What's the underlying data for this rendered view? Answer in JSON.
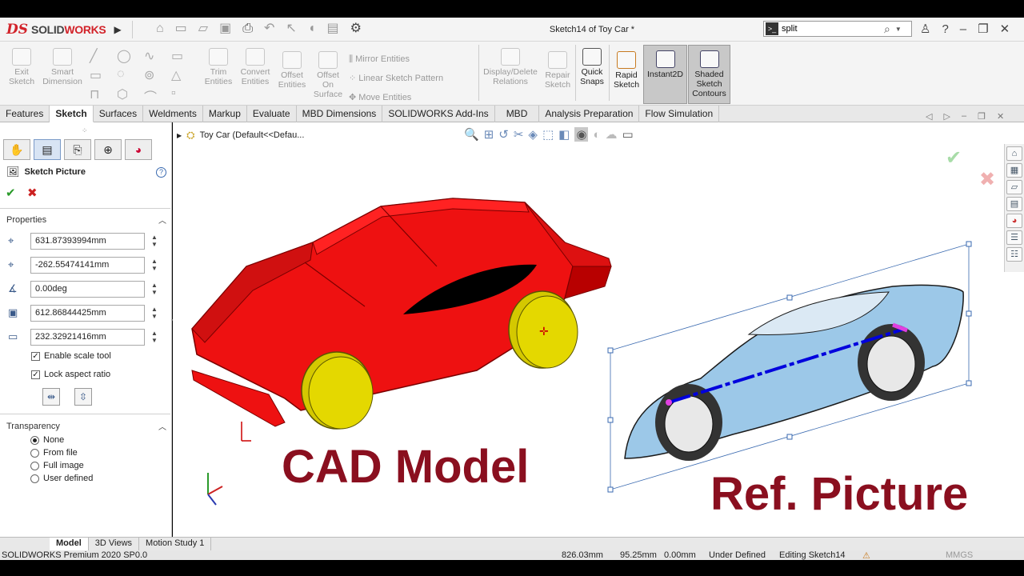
{
  "app": {
    "brand": "SOLIDWORKS",
    "document_title": "Sketch14 of Toy Car *"
  },
  "search": {
    "value": "split"
  },
  "cmd": {
    "exit_sketch": "Exit Sketch",
    "smart_dimension": "Smart Dimension",
    "trim_entities": "Trim Entities",
    "convert_entities": "Convert Entities",
    "offset_entities": "Offset Entities",
    "offset_on_surface": "Offset On Surface",
    "mirror_entities": "Mirror Entities",
    "linear_sketch_pattern": "Linear Sketch Pattern",
    "move_entities": "Move Entities",
    "display_delete_relations": "Display/Delete Relations",
    "repair_sketch": "Repair Sketch",
    "quick_snaps": "Quick Snaps",
    "rapid_sketch": "Rapid Sketch",
    "instant2d": "Instant2D",
    "shaded_sketch_contours": "Shaded Sketch Contours"
  },
  "tabs": [
    "Features",
    "Sketch",
    "Surfaces",
    "Weldments",
    "Markup",
    "Evaluate",
    "MBD Dimensions",
    "SOLIDWORKS Add-Ins",
    "MBD",
    "Analysis Preparation",
    "Flow Simulation"
  ],
  "tree": {
    "item": "Toy Car  (Default<<Defau..."
  },
  "panel": {
    "title": "Sketch Picture",
    "properties_label": "Properties",
    "fields": [
      "631.87393994mm",
      "-262.55474141mm",
      "0.00deg",
      "612.86844425mm",
      "232.32921416mm"
    ],
    "enable_scale_tool": "Enable scale tool",
    "lock_aspect_ratio": "Lock aspect ratio",
    "transparency_label": "Transparency",
    "transparency_options": [
      "None",
      "From file",
      "Full image",
      "User defined"
    ],
    "transparency_selected": "None"
  },
  "viewport": {
    "cad_label": "CAD Model",
    "ref_label": "Ref. Picture"
  },
  "bottom_tabs": [
    "Model",
    "3D Views",
    "Motion Study 1"
  ],
  "status": {
    "product": "SOLIDWORKS Premium 2020 SP0.0",
    "coord1": "826.03mm",
    "coord2": "95.25mm",
    "coord3": "0.00mm",
    "state": "Under Defined",
    "editing": "Editing Sketch14",
    "units": "MMGS"
  },
  "colors": {
    "car_red": "#ee1111",
    "wheel_yellow": "#d4c800",
    "label_red": "#8a0f1f",
    "ref_car_blue": "#9cc8e8"
  }
}
